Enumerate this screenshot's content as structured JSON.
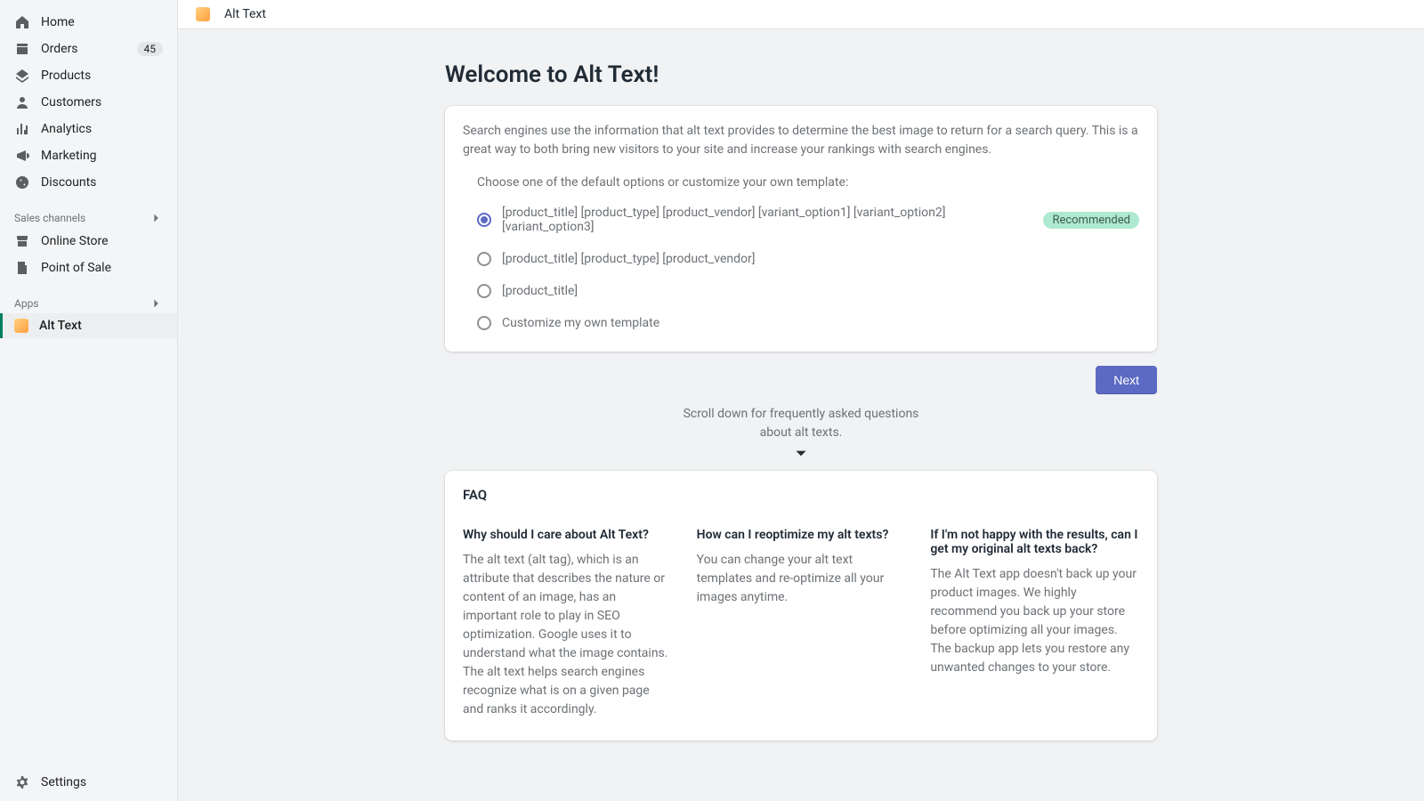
{
  "topbar": {
    "app_name": "Alt Text"
  },
  "sidebar": {
    "main": [
      {
        "icon": "home",
        "label": "Home"
      },
      {
        "icon": "orders",
        "label": "Orders",
        "badge": "45"
      },
      {
        "icon": "products",
        "label": "Products"
      },
      {
        "icon": "customers",
        "label": "Customers"
      },
      {
        "icon": "analytics",
        "label": "Analytics"
      },
      {
        "icon": "marketing",
        "label": "Marketing"
      },
      {
        "icon": "discounts",
        "label": "Discounts"
      }
    ],
    "channels_header": "Sales channels",
    "channels": [
      {
        "icon": "store",
        "label": "Online Store"
      },
      {
        "icon": "pos",
        "label": "Point of Sale"
      }
    ],
    "apps_header": "Apps",
    "apps": [
      {
        "icon": "alttext",
        "label": "Alt Text",
        "active": true
      }
    ],
    "settings_label": "Settings"
  },
  "page": {
    "title": "Welcome to Alt Text!",
    "description": "Search engines use the information that alt text provides to determine the best image to return for a search query. This is a great way to both bring new visitors to your site and increase your rankings with search engines.",
    "options_prompt": "Choose one of the default options or customize your own template:",
    "options": [
      {
        "label": "[product_title] [product_type] [product_vendor] [variant_option1] [variant_option2] [variant_option3]",
        "recommended": true,
        "selected": true
      },
      {
        "label": "[product_title] [product_type] [product_vendor]"
      },
      {
        "label": "[product_title]"
      },
      {
        "label": "Customize my own template"
      }
    ],
    "recommended_text": "Recommended",
    "next_button": "Next",
    "scroll_hint": "Scroll down for frequently asked questions about alt texts."
  },
  "faq": {
    "title": "FAQ",
    "items": [
      {
        "q": "Why should I care about Alt Text?",
        "a": "The alt text (alt tag), which is an attribute that describes the nature or content of an image, has an important role to play in SEO optimization. Google uses it to understand what the image contains. The alt text helps search engines recognize what is on a given page and ranks it accordingly."
      },
      {
        "q": "How can I reoptimize my alt texts?",
        "a": "You can change your alt text templates and re-optimize all your images anytime."
      },
      {
        "q": "If I'm not happy with the results, can I get my original alt texts back?",
        "a": "The Alt Text app doesn't back up your product images. We highly recommend you back up your store before optimizing all your images. The backup app lets you restore any unwanted changes to your store."
      }
    ]
  }
}
